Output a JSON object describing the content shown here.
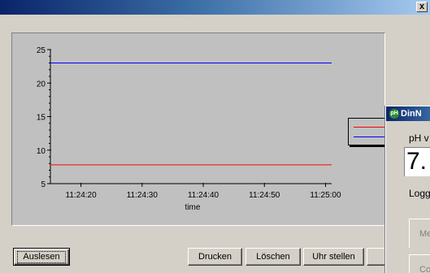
{
  "window": {
    "close_label": "x"
  },
  "chart_data": {
    "type": "line",
    "title": "",
    "xlabel": "time",
    "ylabel": "",
    "ylim": [
      5,
      25
    ],
    "yticks": [
      5,
      10,
      15,
      20,
      25
    ],
    "x": [
      "11:24:15",
      "11:25:01"
    ],
    "xticks": [
      "11:24:20",
      "11:24:30",
      "11:24:40",
      "11:24:50",
      "11:25:00"
    ],
    "grid": false,
    "legend_position": "right",
    "series": [
      {
        "color": "#0000ff",
        "values": [
          23,
          23
        ]
      },
      {
        "color": "#ff0000",
        "values": [
          7.8,
          7.8
        ]
      }
    ]
  },
  "buttons": {
    "auslesen": "Auslesen",
    "drucken": "Drucken",
    "loeschen": "Löschen",
    "uhr_stellen": "Uhr stellen"
  },
  "dialog": {
    "icon_text": "pH",
    "title": "DinN",
    "ph_label": "pH v",
    "value": "7.",
    "logger_label": "Logg",
    "button1": "Me",
    "button2": "Co"
  },
  "colors": {
    "title_bar": "#0a246a",
    "window_bg": "#d4d0c8",
    "plot_bg": "#c0c0c0",
    "series_blue": "#0000ff",
    "series_red": "#ff0000"
  }
}
